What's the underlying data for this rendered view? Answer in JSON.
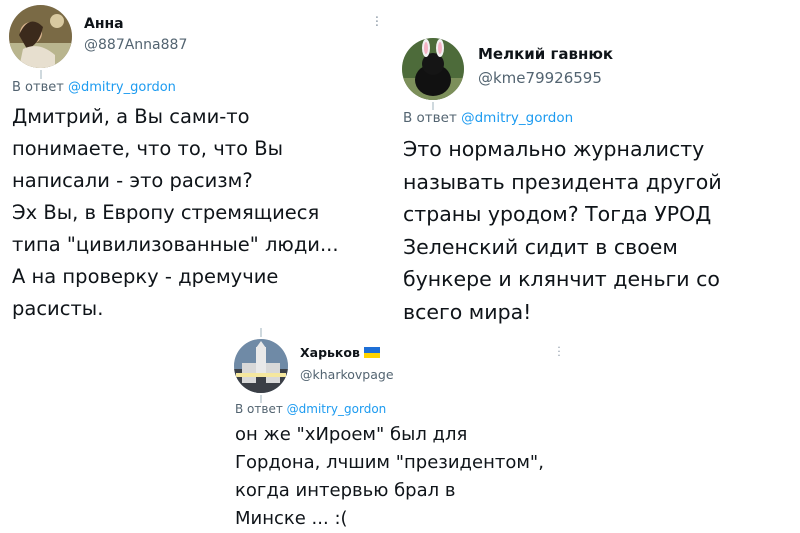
{
  "tweets": [
    {
      "author": "Анна",
      "handle": "@887Anna887",
      "reply_prefix": "В ответ ",
      "reply_mention": "@dmitry_gordon",
      "text": "Дмитрий, а Вы сами-то\nпонимаете, что то, что Вы\nнаписали - это расизм?\nЭх Вы, в Европу стремящиеся\nтипа \"цивилизованные\" люди...\nА на проверку - дремучие\nрасисты."
    },
    {
      "author": "Мелкий гавнюк",
      "handle": "@kme79926595",
      "reply_prefix": "В ответ ",
      "reply_mention": "@dmitry_gordon",
      "text": "Это нормально журналисту\nназывать президента другой\nстраны уродом? Тогда УРОД\nЗеленский сидит в своем\nбункере и клянчит деньги со\nвсего мира!"
    },
    {
      "author": "Харьков",
      "handle": "@kharkovpage",
      "reply_prefix": "В ответ ",
      "reply_mention": "@dmitry_gordon",
      "text": "он же \"хИроем\" был для\nГордона, лчшим \"президентом\",\nкогда интервью брал в\nМинске ... :("
    }
  ],
  "colors": {
    "link": "#1d9bf0",
    "secondary_text": "#536471",
    "flag_blue": "#1e6fd6",
    "flag_yellow": "#ffd400"
  },
  "icons": {
    "more": "more-vertical-icon",
    "flag": "ukraine-flag-icon"
  }
}
